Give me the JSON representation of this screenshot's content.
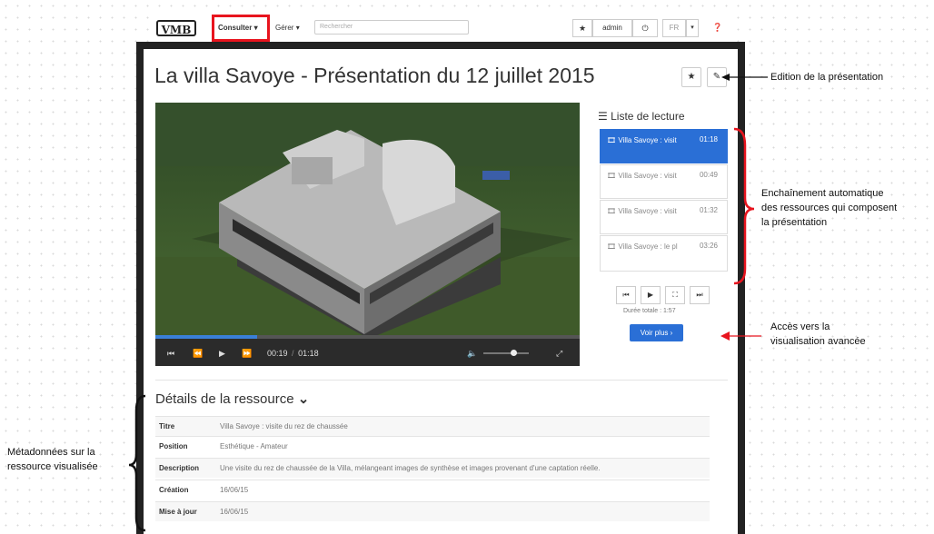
{
  "navbar": {
    "logo": "VMB",
    "consulter": "Consulter",
    "gerer": "Gérer",
    "search_placeholder": "Rechercher",
    "user": "admin",
    "lang": "FR"
  },
  "page": {
    "title": "La villa Savoye - Présentation du 12 juillet 2015"
  },
  "player": {
    "current_time": "00:19",
    "separator": "/",
    "duration": "01:18",
    "progress": 0.24,
    "volume": 0.6
  },
  "playlist": {
    "heading": "Liste de lecture",
    "items": [
      {
        "name": "Villa Savoye : visit",
        "time": "01:18",
        "active": true
      },
      {
        "name": "Villa Savoye : visit",
        "time": "00:49",
        "active": false
      },
      {
        "name": "Villa Savoye : visit",
        "time": "01:32",
        "active": false
      },
      {
        "name": "Villa Savoye : le pl",
        "time": "03:26",
        "active": false
      }
    ],
    "total_duration": "Durée totale : 1:57",
    "voir_plus": "Voir plus"
  },
  "details": {
    "heading": "Détails de la ressource",
    "rows": [
      {
        "key": "Titre",
        "value": "Villa Savoye : visite du rez de chaussée"
      },
      {
        "key": "Position",
        "value": "Esthétique - Amateur"
      },
      {
        "key": "Description",
        "value": "Une visite du rez de chaussée de la Villa, mélangeant images de synthèse et images provenant d'une captation réelle."
      },
      {
        "key": "Création",
        "value": "16/06/15"
      },
      {
        "key": "Mise à jour",
        "value": "16/06/15"
      }
    ]
  },
  "annotations": {
    "edition": "Edition de la présentation",
    "enchainement": [
      "Enchaînement automatique",
      "des ressources qui composent",
      "la présentation"
    ],
    "acces": [
      "Accès vers la",
      "visualisation avancée"
    ],
    "metadonnees": [
      "Métadonnées sur la",
      "ressource visualisée"
    ]
  }
}
